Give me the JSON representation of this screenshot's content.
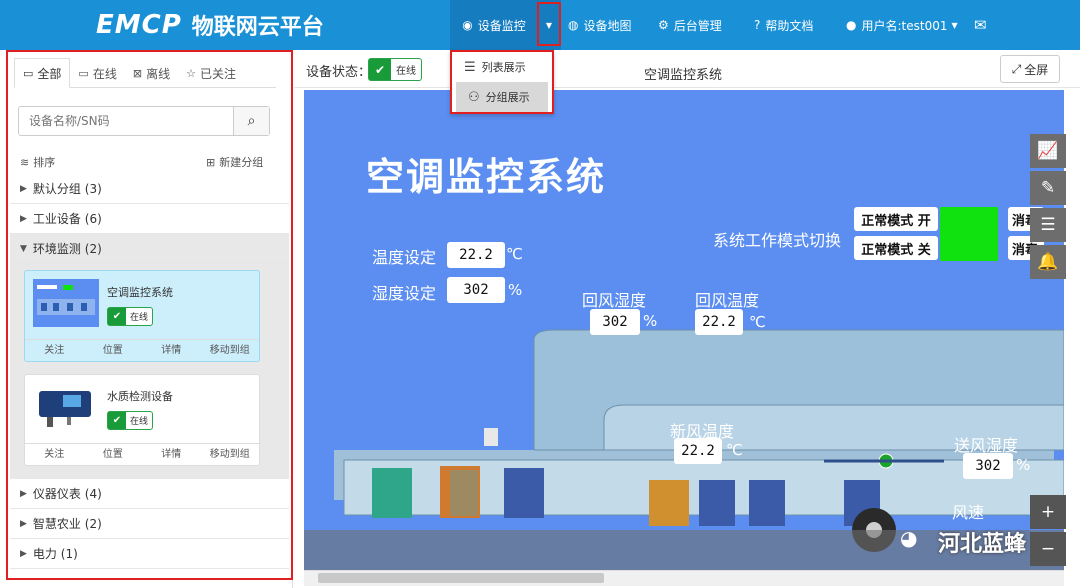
{
  "brand": {
    "logo_mark": "EMCP",
    "logo_text": "物联网云平台"
  },
  "nav": {
    "monitor": "设备监控",
    "map": "设备地图",
    "admin": "后台管理",
    "help": "帮助文档",
    "user": "用户名:test001"
  },
  "dropdown": {
    "list_view": "列表展示",
    "group_view": "分组展示"
  },
  "sidebar": {
    "tabs": [
      "全部",
      "在线",
      "离线",
      "已关注"
    ],
    "search_placeholder": "设备名称/SN码",
    "sort_label": "排序",
    "new_group_label": "新建分组",
    "groups": [
      {
        "label": "默认分组",
        "count": "(3)"
      },
      {
        "label": "工业设备",
        "count": "(6)"
      },
      {
        "label": "环境监测",
        "count": "(2)"
      },
      {
        "label": "仪器仪表",
        "count": "(4)"
      },
      {
        "label": "智慧农业",
        "count": "(2)"
      },
      {
        "label": "电力",
        "count": "(1)"
      }
    ],
    "devices": [
      {
        "name": "空调监控系统",
        "status": "在线",
        "actions": [
          "关注",
          "位置",
          "详情",
          "移动到组"
        ]
      },
      {
        "name": "水质检测设备",
        "status": "在线",
        "actions": [
          "关注",
          "位置",
          "详情",
          "移动到组"
        ]
      }
    ]
  },
  "header": {
    "status_label": "设备状态：",
    "status_value": "在线",
    "page_title": "空调监控系统",
    "fullscreen": "全屏"
  },
  "scada": {
    "title": "空调监控系统",
    "temp_set_label": "温度设定",
    "temp_set_value": "22.2",
    "temp_unit": "℃",
    "hum_set_label": "湿度设定",
    "hum_set_value": "302",
    "hum_unit": "%",
    "return_hum_label": "回风湿度",
    "return_hum_value": "302",
    "return_hum_unit": "%",
    "return_temp_label": "回风温度",
    "return_temp_value": "22.2",
    "return_temp_unit": "℃",
    "mode_switch_label": "系统工作模式切换",
    "mode_on": "正常模式 开",
    "mode_off": "正常模式 关",
    "mode_extra_1": "消毒",
    "mode_extra_2": "消毒",
    "fresh_temp_label": "新风温度",
    "fresh_temp_value": "22.2",
    "fresh_temp_unit": "℃",
    "supply_hum_label": "送风湿度",
    "supply_hum_value": "302",
    "supply_hum_unit": "%",
    "wind_label": "风速"
  },
  "watermark": "河北蓝蜂",
  "colors": {
    "topbar": "#1a90d6",
    "online": "#1a9b3a",
    "canvas": "#5b8ef0",
    "mode_indicator": "#0fe20f"
  }
}
